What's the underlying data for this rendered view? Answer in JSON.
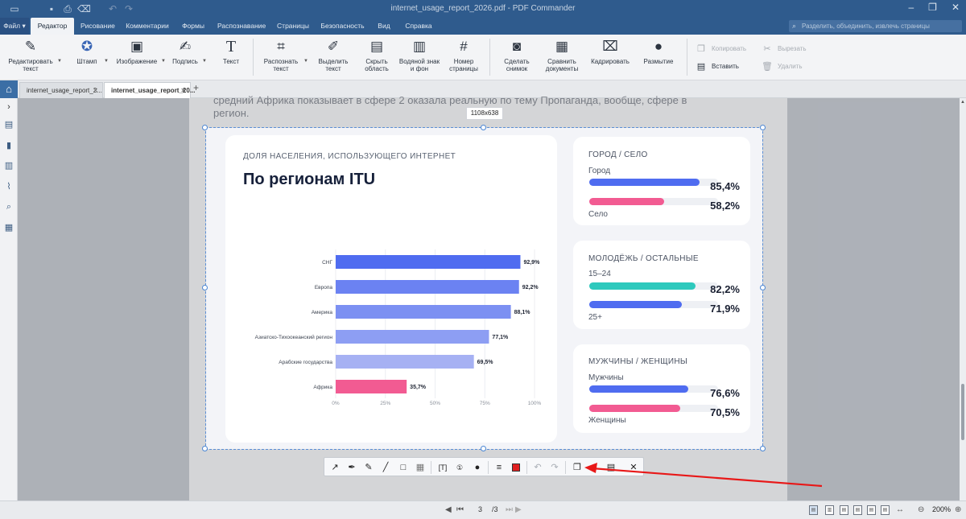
{
  "titlebar": {
    "title": "internet_usage_report_2026.pdf - PDF Commander"
  },
  "menu": {
    "file": "Файл",
    "items": [
      "Редактор",
      "Рисование",
      "Комментарии",
      "Формы",
      "Распознавание",
      "Страницы",
      "Безопасность",
      "Вид",
      "Справка"
    ],
    "search_placeholder": "Разделить, объединить, извлечь страницы"
  },
  "ribbon": {
    "edit_text": "Редактировать\nтекст",
    "stamp": "Штамп",
    "image": "Изображение",
    "signature": "Подпись",
    "text": "Текст",
    "recognize": "Распознать\nтекст",
    "select_text": "Выделить\nтекст",
    "hide_area": "Скрыть\nобласть",
    "watermark": "Водяной знак\nи фон",
    "page_number": "Номер\nстраницы",
    "snapshot": "Сделать\nснимок",
    "compare": "Сравнить\nдокументы",
    "crop": "Кадрировать",
    "blur": "Размытие",
    "copy": "Копировать",
    "paste": "Вставить",
    "cut": "Вырезать",
    "delete": "Удалить"
  },
  "tabs": [
    "internet_usage_report_2...",
    "internet_usage_report_20..."
  ],
  "page": {
    "text_line1": "средний Африка показывает в сфере 2 оказала реальную по тему Пропаганда, вообще, сфере в",
    "text_line2": "регион."
  },
  "selection": {
    "size_label": "1108x638"
  },
  "infographic": {
    "kicker": "ДОЛЯ НАСЕЛЕНИЯ, ИСПОЛЬЗУЮЩЕГО ИНТЕРНЕТ",
    "title": "По регионам ITU",
    "cards": [
      {
        "head": "ГОРОД / СЕЛО",
        "top_label": "Город",
        "top_value": "85,4%",
        "top_pct": 85.4,
        "top_color": "#4f6cf0",
        "bottom_label": "Село",
        "bottom_value": "58,2%",
        "bottom_pct": 58.2,
        "bottom_color": "#f25b92"
      },
      {
        "head": "МОЛОДЁЖЬ / ОСТАЛЬНЫЕ",
        "top_label": "15–24",
        "top_value": "82,2%",
        "top_pct": 82.2,
        "top_color": "#2ec9bd",
        "bottom_label": "25+",
        "bottom_value": "71,9%",
        "bottom_pct": 71.9,
        "bottom_color": "#4f6cf0"
      },
      {
        "head": "МУЖЧИНЫ / ЖЕНЩИНЫ",
        "top_label": "Мужчины",
        "top_value": "76,6%",
        "top_pct": 76.6,
        "top_color": "#4f6cf0",
        "bottom_label": "Женщины",
        "bottom_value": "70,5%",
        "bottom_pct": 70.5,
        "bottom_color": "#f25b92"
      }
    ]
  },
  "chart_data": {
    "type": "bar",
    "orientation": "horizontal",
    "categories": [
      "СНГ",
      "Европа",
      "Америка",
      "Азиатско-Тихоокеанский регион",
      "Арабские государства",
      "Африка"
    ],
    "values": [
      92.9,
      92.2,
      88.1,
      77.1,
      69.5,
      35.7
    ],
    "value_labels": [
      "92,9%",
      "92,2%",
      "88,1%",
      "77,1%",
      "69,5%",
      "35,7%"
    ],
    "colors": [
      "#4f6cf0",
      "#6b82f2",
      "#7c90f2",
      "#8d9ef3",
      "#a6b1f3",
      "#f25b92"
    ],
    "xticks": [
      "0%",
      "25%",
      "50%",
      "75%",
      "100%"
    ],
    "xlim": [
      0,
      100
    ]
  },
  "floatbar": {
    "tools": [
      "arrow-icon",
      "pen-icon",
      "marker-icon",
      "line-icon",
      "rect-icon",
      "filled-rect-icon",
      "text-box-icon",
      "number-icon",
      "blur-drop-icon",
      "line-width-icon",
      "color-swatch-icon",
      "undo-icon",
      "redo-icon",
      "copy-icon",
      "save-icon",
      "export-icon",
      "close-icon"
    ],
    "swatch_color": "#e02020"
  },
  "status": {
    "page_current": "3",
    "page_total": "/3",
    "zoom": "200%"
  }
}
